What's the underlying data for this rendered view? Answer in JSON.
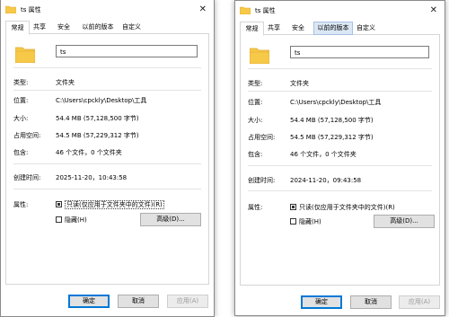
{
  "colors": {
    "folder": "#f7c948",
    "folder_dark": "#e0a82e",
    "accent": "#0078d7",
    "tab_hover": "#dbe7f4"
  },
  "left": {
    "title": "ts 属性",
    "tabs": [
      "常规",
      "共享",
      "安全",
      "以前的版本",
      "自定义"
    ],
    "name_value": "ts",
    "type_label": "类型:",
    "type_value": "文件夹",
    "location_label": "位置:",
    "location_value": "C:\\Users\\cpckly\\Desktop\\工具",
    "size_label": "大小:",
    "size_value": "54.4 MB (57,128,500 字节)",
    "disk_label": "占用空间:",
    "disk_value": "54.5 MB (57,229,312 字节)",
    "contains_label": "包含:",
    "contains_value": "46 个文件，0 个文件夹",
    "created_label": "创建时间:",
    "created_value": "2025-11-20，10:43:58",
    "attributes_label": "属性:",
    "readonly_label": "只读(仅应用于文件夹中的文件)(R)",
    "hidden_label": "隐藏(H)",
    "advanced_label": "高级(D)...",
    "ok_label": "确定",
    "cancel_label": "取消",
    "apply_label": "应用(A)"
  },
  "right": {
    "title": "ts 属性",
    "tabs": [
      "常规",
      "共享",
      "安全",
      "以前的版本",
      "自定义"
    ],
    "name_value": "ts",
    "type_label": "类型:",
    "type_value": "文件夹",
    "location_label": "位置:",
    "location_value": "C:\\Users\\cpckly\\Desktop\\工具",
    "size_label": "大小:",
    "size_value": "54.4 MB (57,128,500 字节)",
    "disk_label": "占用空间:",
    "disk_value": "54.5 MB (57,229,312 字节)",
    "contains_label": "包含:",
    "contains_value": "46 个文件，0 个文件夹",
    "created_label": "创建时间:",
    "created_value": "2024-11-20，09:43:58",
    "attributes_label": "属性:",
    "readonly_label": "只读(仅应用于文件夹中的文件)(R)",
    "hidden_label": "隐藏(H)",
    "advanced_label": "高级(D)...",
    "ok_label": "确定",
    "cancel_label": "取消",
    "apply_label": "应用(A)"
  }
}
